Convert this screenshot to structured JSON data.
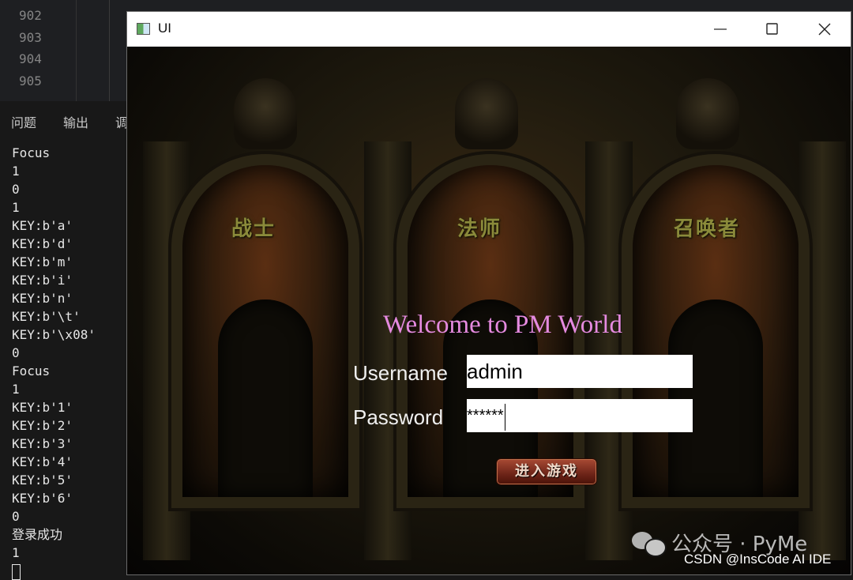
{
  "editor": {
    "line_numbers": [
      "902",
      "903",
      "904",
      "905"
    ]
  },
  "panel": {
    "tabs": [
      "问题",
      "输出",
      "调"
    ]
  },
  "terminal": {
    "lines": [
      "Focus",
      "1",
      "0",
      "1",
      "KEY:b'a'",
      "KEY:b'd'",
      "KEY:b'm'",
      "KEY:b'i'",
      "KEY:b'n'",
      "KEY:b'\\t'",
      "KEY:b'\\x08'",
      "0",
      "Focus",
      "1",
      "KEY:b'1'",
      "KEY:b'2'",
      "KEY:b'3'",
      "KEY:b'4'",
      "KEY:b'5'",
      "KEY:b'6'",
      "0",
      "登录成功",
      "1"
    ]
  },
  "window": {
    "title": "UI",
    "icon": "app-window-icon",
    "controls": [
      "minimize-icon",
      "maximize-icon",
      "close-icon"
    ]
  },
  "game": {
    "arch_labels": [
      "战士",
      "法师",
      "召唤者"
    ],
    "welcome": "Welcome to PM World",
    "username_label": "Username",
    "username_value": "admin",
    "password_label": "Password",
    "password_value": "******",
    "enter_button": "进入游戏"
  },
  "watermark": {
    "text": "公众号 · PyMe",
    "icon": "wechat-icon"
  },
  "credit": "CSDN @InsCode AI IDE",
  "colors": {
    "welcome_text": "#e58ae0",
    "ide_background": "#181818",
    "button": "#6d2418"
  }
}
